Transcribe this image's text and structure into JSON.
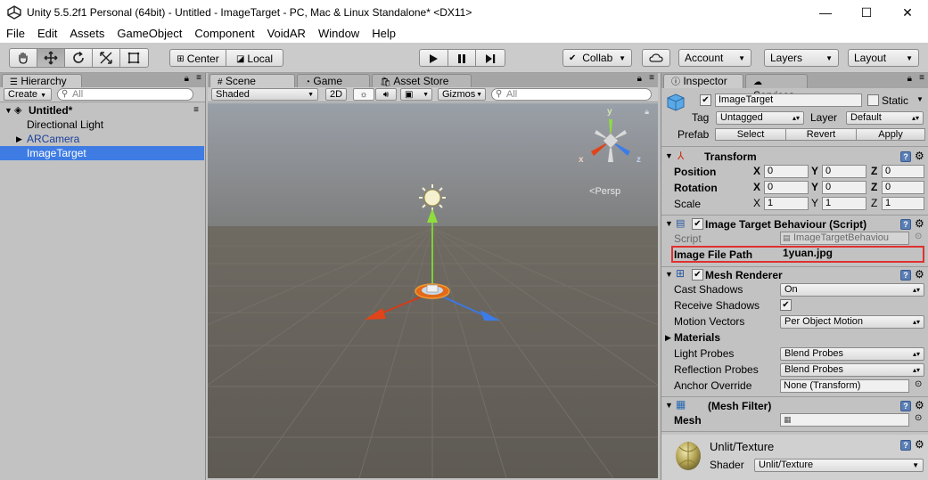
{
  "window": {
    "title": "Unity 5.5.2f1 Personal (64bit) - Untitled - ImageTarget - PC, Mac & Linux Standalone* <DX11>",
    "minimize": "—",
    "maximize": "☐",
    "close": "✕"
  },
  "menu": [
    "File",
    "Edit",
    "Assets",
    "GameObject",
    "Component",
    "VoidAR",
    "Window",
    "Help"
  ],
  "toolbar": {
    "pivot_center": "Center",
    "pivot_local": "Local",
    "collab": "Collab",
    "account": "Account",
    "layers": "Layers",
    "layout": "Layout"
  },
  "hierarchy": {
    "tab": "Hierarchy",
    "create": "Create",
    "search_placeholder": "All",
    "scene_name": "Untitled*",
    "items": [
      {
        "label": "Directional Light"
      },
      {
        "label": "ARCamera"
      },
      {
        "label": "ImageTarget"
      }
    ]
  },
  "scene": {
    "tabs": [
      "Scene",
      "Game",
      "Asset Store"
    ],
    "shading": "Shaded",
    "mode_2d": "2D",
    "gizmos": "Gizmos",
    "search_placeholder": "All",
    "persp": "Persp",
    "axis_x": "x",
    "axis_y": "y",
    "axis_z": "z"
  },
  "inspector": {
    "tabs": [
      "Inspector",
      "Services"
    ],
    "object_name": "ImageTarget",
    "static_label": "Static",
    "tag_label": "Tag",
    "tag_value": "Untagged",
    "layer_label": "Layer",
    "layer_value": "Default",
    "prefab_label": "Prefab",
    "prefab_select": "Select",
    "prefab_revert": "Revert",
    "prefab_apply": "Apply",
    "transform": {
      "title": "Transform",
      "position_label": "Position",
      "rotation_label": "Rotation",
      "scale_label": "Scale",
      "position": [
        "0",
        "0",
        "0"
      ],
      "rotation": [
        "0",
        "0",
        "0"
      ],
      "scale": [
        "1",
        "1",
        "1"
      ]
    },
    "itb": {
      "title": "Image Target Behaviour (Script)",
      "script_label": "Script",
      "script_value": "ImageTargetBehaviou",
      "path_label": "Image File Path",
      "path_value": "1yuan.jpg"
    },
    "mesh_renderer": {
      "title": "Mesh Renderer",
      "cast_shadows_label": "Cast Shadows",
      "cast_shadows_value": "On",
      "receive_shadows_label": "Receive Shadows",
      "motion_vectors_label": "Motion Vectors",
      "motion_vectors_value": "Per Object Motion",
      "materials_label": "Materials",
      "light_probes_label": "Light Probes",
      "light_probes_value": "Blend Probes",
      "reflection_probes_label": "Reflection Probes",
      "reflection_probes_value": "Blend Probes",
      "anchor_override_label": "Anchor Override",
      "anchor_override_value": "None (Transform)"
    },
    "mesh_filter": {
      "title": "(Mesh Filter)",
      "mesh_label": "Mesh"
    },
    "material": {
      "title": "Unlit/Texture",
      "shader_label": "Shader",
      "shader_value": "Unlit/Texture"
    }
  }
}
